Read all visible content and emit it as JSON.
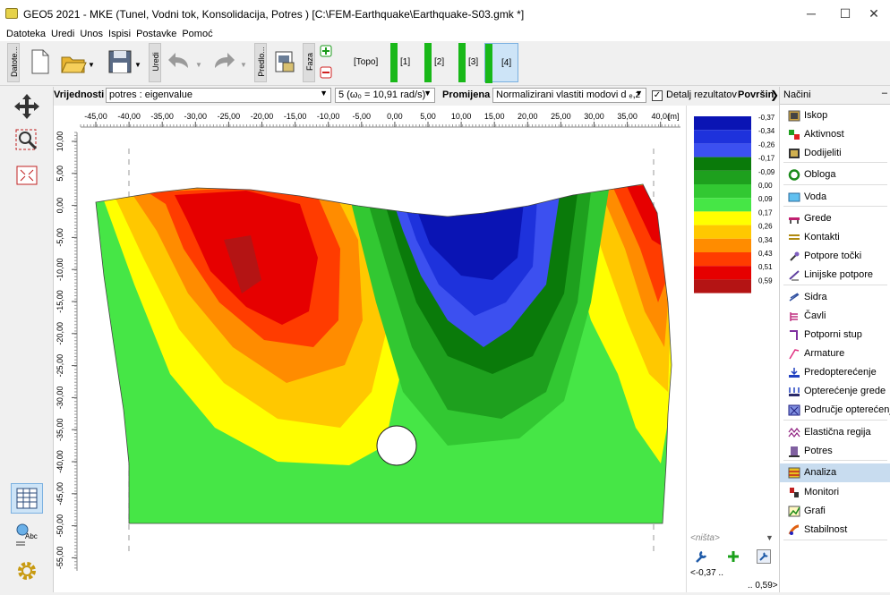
{
  "window": {
    "title": "GEO5 2021 - MKE (Tunel, Vodni tok, Konsolidacija, Potres ) [C:\\FEM-Earthquake\\Earthquake-S03.gmk *]",
    "minimize": "─",
    "maximize": "☐",
    "close": "✕"
  },
  "menu": [
    "Datoteka",
    "Uredi",
    "Unos",
    "Ispisi",
    "Postavke",
    "Pomoć"
  ],
  "toolbar": {
    "group_file": "Datote...",
    "group_edit": "Uredi",
    "group_preview": "Predlo...",
    "group_phase": "Faza",
    "phases": [
      "[Topo]",
      "[1]",
      "[2]",
      "[3]",
      "[4]"
    ],
    "active_phase": "[4]"
  },
  "params": {
    "values_label": "Vrijednosti :",
    "values_select": "potres : eigenvalue",
    "mode_select": "5 (ω₀ = 10,91 rad/s)",
    "change_label": "Promijena :",
    "change_select": "Normalizirani vlastiti modovi d ₑ,z",
    "detail_label": "Detalj rezultatov",
    "surface_label": "Površin"
  },
  "ruler": {
    "x_ticks": [
      "-45,00",
      "-40,00",
      "-35,00",
      "-30,00",
      "-25,00",
      "-20,00",
      "-15,00",
      "-10,00",
      "-5,00",
      "0,00",
      "5,00",
      "10,00",
      "15,00",
      "20,00",
      "25,00",
      "30,00",
      "35,00",
      "40,0("
    ],
    "x_unit": "[m]",
    "y_ticks": [
      "10,00",
      "5,00",
      "0,00",
      "-5,00",
      "-10,00",
      "-15,00",
      "-20,00",
      "-25,00",
      "-30,00",
      "-35,00",
      "-40,00",
      "-45,00",
      "-50,00",
      "-55,00"
    ]
  },
  "legend": {
    "values": [
      "-0,37",
      "-0,34",
      "-0,26",
      "-0,17",
      "-0,09",
      "0,00",
      "0,09",
      "0,17",
      "0,26",
      "0,34",
      "0,43",
      "0,51",
      "0,59"
    ],
    "colors": [
      "#0a14b4",
      "#1e32dc",
      "#3c50f0",
      "#0a7a0a",
      "#1ea01e",
      "#32c832",
      "#46e646",
      "#ffff00",
      "#ffc800",
      "#ff8c00",
      "#ff3c00",
      "#e60000",
      "#b41414"
    ],
    "nothing": "<ništa>",
    "min": "<-0,37 ..",
    "max": ".. 0,59>"
  },
  "right_panel": {
    "header": "Načini",
    "items": [
      "Iskop",
      "Aktivnost",
      "Dodijeliti",
      "Obloga",
      "Voda",
      "Grede",
      "Kontakti",
      "Potpore točki",
      "Linijske potpore",
      "Sidra",
      "Čavli",
      "Potporni stup",
      "Armature",
      "Predopterećenje",
      "Opterećenje grede",
      "Područje opterećenja",
      "Elastična regija",
      "Potres",
      "Analiza",
      "Monitori",
      "Grafi",
      "Stabilnost"
    ],
    "selected": "Analiza"
  }
}
